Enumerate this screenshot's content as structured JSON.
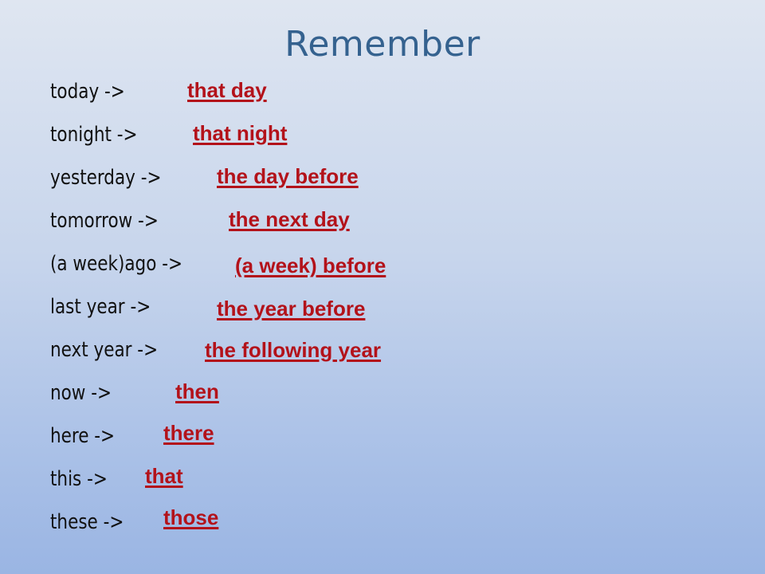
{
  "title": "Remember",
  "rows": [
    {
      "from": "today ->",
      "to": "that day"
    },
    {
      "from": "tonight ->",
      "to": "that night"
    },
    {
      "from": "yesterday ->",
      "to": "the day before"
    },
    {
      "from": "tomorrow ->",
      "to": "the next day"
    },
    {
      "from": "(a week)ago ->",
      "to": "(a week) before"
    },
    {
      "from": "last year ->",
      "to": "the year before"
    },
    {
      "from": "next year ->",
      "to": "the following year"
    },
    {
      "from": "now ->",
      "to": "then"
    },
    {
      "from": "here ->",
      "to": "there"
    },
    {
      "from": "this ->",
      "to": "that"
    },
    {
      "from": "these ->",
      "to": "those"
    }
  ],
  "colors": {
    "title": "#35628f",
    "replacement": "#b3121a",
    "source": "#111111"
  }
}
